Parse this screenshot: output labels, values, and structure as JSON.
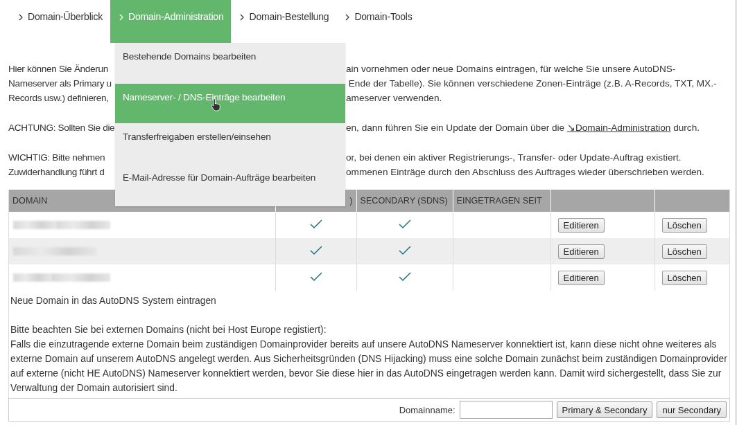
{
  "tabs": [
    {
      "label": "Domain-Überblick",
      "selected": false
    },
    {
      "label": "Domain-Administration",
      "selected": true
    },
    {
      "label": "Domain-Bestellung",
      "selected": false
    },
    {
      "label": "Domain-Tools",
      "selected": false
    }
  ],
  "menu": {
    "items": [
      {
        "label": "Bestehende Domains bearbeiten",
        "selected": false,
        "cursor": false
      },
      {
        "label": "Nameserver- / DNS-Einträge bearbeiten",
        "selected": true,
        "cursor": true
      },
      {
        "label": "Transferfreigaben erstellen/einsehen",
        "selected": false,
        "cursor": false
      },
      {
        "label": "E-Mail-Adresse für Domain-Aufträge bearbeiten",
        "selected": false,
        "cursor": false
      }
    ]
  },
  "paragraphs": [
    {
      "lines": [
        {
          "left": "Hier können Sie Änderun",
          "right": "ain vornehmen oder neue Domains eintragen, für welche Sie unsere AutoDNS-"
        },
        {
          "left": "Nameserver als Primary u",
          "right": " Ende der Tabelle). Sie können verschiedene Zonen-Einträge (z.B. A-Records, TXT, MX.-"
        },
        {
          "left": "Records usw.) definieren,",
          "right": "ameserver verwenden."
        }
      ]
    },
    {
      "lines": [
        {
          "left": "ACHTUNG: Sollten Sie die",
          "right": "en, dann führen Sie ein Update der Domain über die ",
          "link": "↘Domain-Administration",
          "after": " durch."
        }
      ]
    },
    {
      "lines": [
        {
          "left": "WICHTIG: Bitte nehmen",
          "right": "or, bei denen ein aktiver Registrierungs-, Transfer- oder Update-Auftrag existiert."
        },
        {
          "left": "Zuwiderhandlung führt d",
          "right": "ommenen Einträge durch den Abschluss des Auftrages wieder überschrieben werden."
        }
      ]
    }
  ],
  "table": {
    "columns": [
      "DOMAIN",
      ")",
      "SECONDARY (SDNS)",
      "EINGETRAGEN SEIT"
    ],
    "rows": [
      {
        "primary_checked": true,
        "secondary_checked": true,
        "edit": "Editieren",
        "delete": "Löschen"
      },
      {
        "primary_checked": true,
        "secondary_checked": true,
        "edit": "Editieren",
        "delete": "Löschen"
      },
      {
        "primary_checked": true,
        "secondary_checked": true,
        "edit": "Editieren",
        "delete": "Löschen"
      }
    ]
  },
  "new_domain": {
    "heading": "Neue Domain in das AutoDNS System eintragen",
    "note_title": "Bitte beachten Sie bei externen Domains (nicht bei Host Europe registiert):",
    "note": "Falls die einzutragende externe Domain beim zuständigen Domainprovider bereits auf unsere AutoDNS Nameserver konnektiert ist, kann diese nicht ohne weiteres als externe Domain auf unserem AutoDNS angelegt werden. Aus Sicherheitsgründen (DNS Hijacking) muss eine solche Domain zunächst beim zuständigen Domainprovider auf externe (nicht HE AutoDNS) Nameserver konnektiert werden, bevor Sie diese hier in das AutoDNS eingetragen werden kann. Damit wird sichergestellt, dass Sie zur Verwaltung der Domain autorisiert sind.",
    "field_label": "Domainname:",
    "buttons": [
      "Primary & Secondary",
      "nur Secondary"
    ]
  }
}
